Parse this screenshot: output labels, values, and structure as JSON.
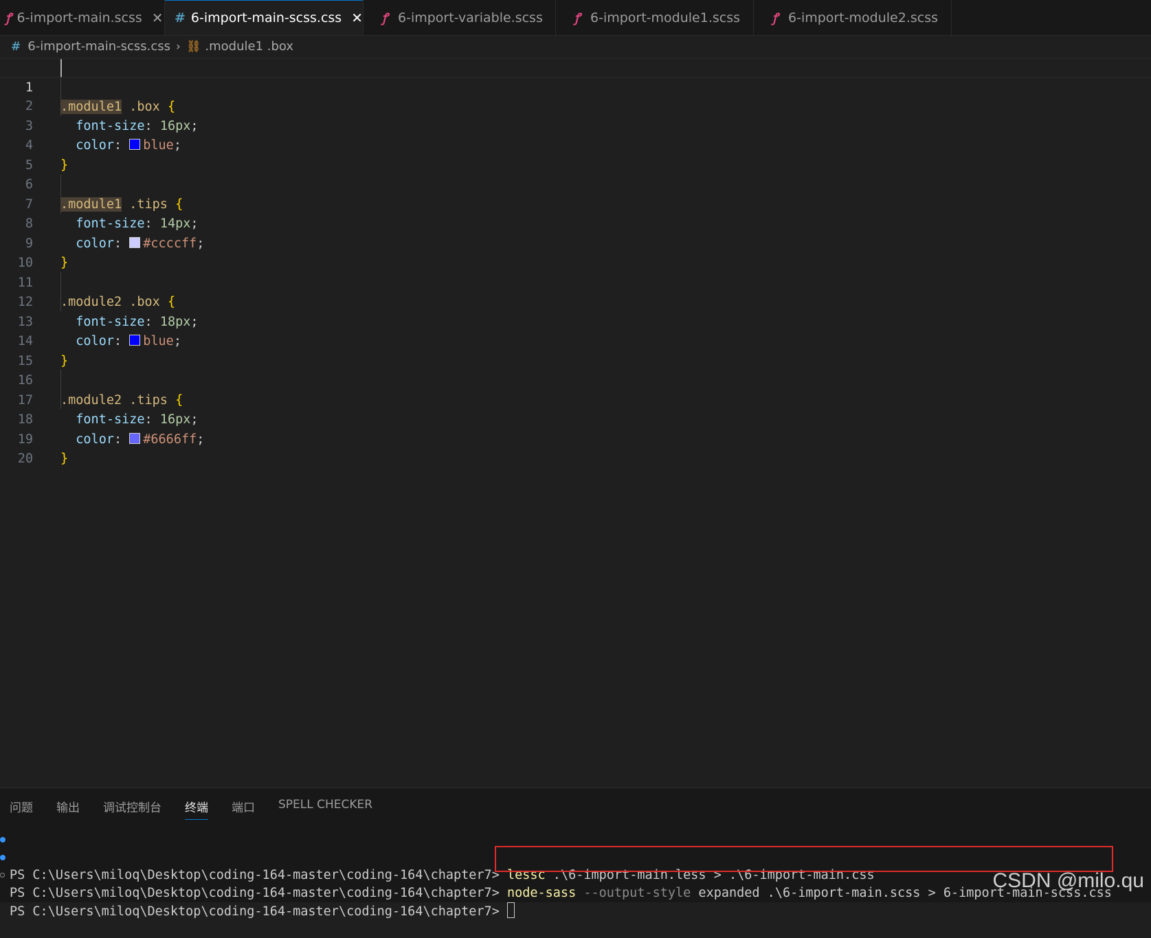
{
  "tabs": [
    {
      "label": "6-import-main.scss",
      "icon": "sass-icon",
      "closable": true,
      "active": false
    },
    {
      "label": "6-import-main-scss.css",
      "icon": "css-hash-icon",
      "closable": true,
      "active": true
    },
    {
      "label": "6-import-variable.scss",
      "icon": "sass-icon",
      "closable": false,
      "active": false
    },
    {
      "label": "6-import-module1.scss",
      "icon": "sass-icon",
      "closable": false,
      "active": false
    },
    {
      "label": "6-import-module2.scss",
      "icon": "sass-icon",
      "closable": false,
      "active": false
    }
  ],
  "breadcrumb": {
    "file": "6-import-main-scss.css",
    "symbol": ".module1 .box"
  },
  "editor": {
    "current_line": 1,
    "line_numbers": [
      "1",
      "2",
      "3",
      "4",
      "5",
      "6",
      "7",
      "8",
      "9",
      "10",
      "11",
      "12",
      "13",
      "14",
      "15",
      "16",
      "17",
      "18",
      "19",
      "20"
    ],
    "blocks": [
      {
        "selector_a": ".module1",
        "selector_b": " .box",
        "brace_open": " {",
        "p1": "font-size",
        "v1": "16px",
        "p2": "color",
        "v2": "blue",
        "swatch": "#0000ff",
        "brace_close": "}"
      },
      {
        "selector_a": ".module1",
        "selector_b": " .tips",
        "brace_open": " {",
        "p1": "font-size",
        "v1": "14px",
        "p2": "color",
        "v2": "#ccccff",
        "swatch": "#ccccff",
        "brace_close": "}"
      },
      {
        "selector_a": ".module2",
        "selector_b": " .box",
        "brace_open": " {",
        "p1": "font-size",
        "v1": "18px",
        "p2": "color",
        "v2": "blue",
        "swatch": "#0000ff",
        "brace_close": "}"
      },
      {
        "selector_a": ".module2",
        "selector_b": " .tips",
        "brace_open": " {",
        "p1": "font-size",
        "v1": "16px",
        "p2": "color",
        "v2": "#6666ff",
        "swatch": "#6666ff",
        "brace_close": "}"
      }
    ]
  },
  "panel": {
    "tabs": [
      "问题",
      "输出",
      "调试控制台",
      "终端",
      "端口",
      "SPELL CHECKER"
    ],
    "active_tab": "终端",
    "terminal": [
      {
        "prompt": "PS C:\\Users\\miloq\\Desktop\\coding-164-master\\coding-164\\chapter7> ",
        "cmd": "lessc",
        "opt": "",
        "rest": " .\\6-import-main.less > .\\6-import-main.css"
      },
      {
        "prompt": "PS C:\\Users\\miloq\\Desktop\\coding-164-master\\coding-164\\chapter7> ",
        "cmd": "node-sass",
        "opt": " --output-style",
        "rest": " expanded .\\6-import-main.scss > 6-import-main-scss.css"
      },
      {
        "prompt": "PS C:\\Users\\miloq\\Desktop\\coding-164-master\\coding-164\\chapter7> ",
        "cmd": "",
        "opt": "",
        "rest": ""
      }
    ]
  },
  "watermark": "CSDN @milo.qu",
  "colors": {
    "accent": "#0078d4",
    "highlight_box": "#e02b2b",
    "selector": "#d7ba7d",
    "property": "#9cdcfe",
    "number": "#b5cea8",
    "string": "#ce9178",
    "brace": "#ffd700"
  }
}
